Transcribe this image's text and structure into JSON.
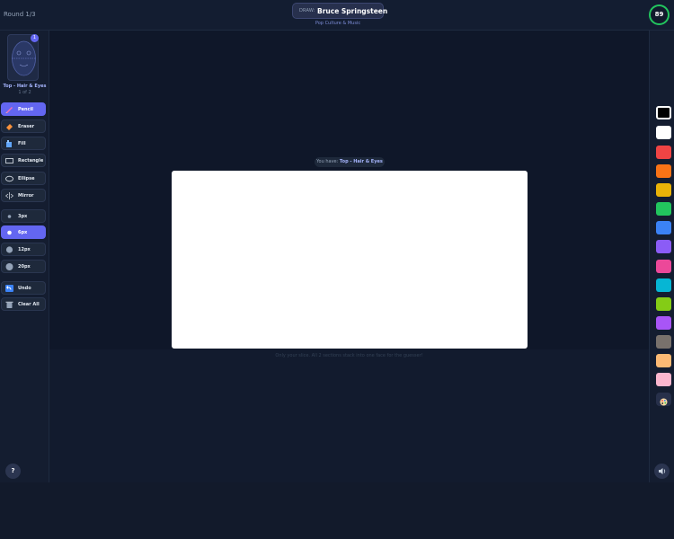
{
  "header": {
    "round": "Round 1/3",
    "draw_prefix": "DRAW:",
    "draw_word": "Bruce Springsteen",
    "category": "Pop Culture & Music",
    "timer": "89"
  },
  "section": {
    "badge": "1",
    "name": "Top - Hair & Eyes",
    "count": "1 of 2"
  },
  "tools": [
    {
      "label": "Pencil",
      "icon": "pencil-icon",
      "active": true
    },
    {
      "label": "Eraser",
      "icon": "eraser-icon",
      "active": false
    },
    {
      "label": "Fill",
      "icon": "fill-icon",
      "active": false
    },
    {
      "label": "Rectangle",
      "icon": "rectangle-icon",
      "active": false
    },
    {
      "label": "Ellipse",
      "icon": "ellipse-icon",
      "active": false
    },
    {
      "label": "Mirror",
      "icon": "mirror-icon",
      "active": false
    }
  ],
  "sizes": [
    {
      "label": "3px",
      "active": false
    },
    {
      "label": "6px",
      "active": true
    },
    {
      "label": "12px",
      "active": false
    },
    {
      "label": "20px",
      "active": false
    }
  ],
  "actions": {
    "undo": "Undo",
    "clear": "Clear All"
  },
  "canvas": {
    "you_have_prefix": "You have:",
    "you_have_section": "Top - Hair & Eyes",
    "hint": "Only your slice. All 2 sections stack into one face for the guesser!"
  },
  "palette": [
    {
      "color": "#000000",
      "selected": true
    },
    {
      "color": "#ffffff",
      "selected": false
    },
    {
      "color": "#ef4444",
      "selected": false
    },
    {
      "color": "#f97316",
      "selected": false
    },
    {
      "color": "#eab308",
      "selected": false
    },
    {
      "color": "#22c55e",
      "selected": false
    },
    {
      "color": "#3b82f6",
      "selected": false
    },
    {
      "color": "#8b5cf6",
      "selected": false
    },
    {
      "color": "#ec4899",
      "selected": false
    },
    {
      "color": "#06b6d4",
      "selected": false
    },
    {
      "color": "#84cc16",
      "selected": false
    },
    {
      "color": "#a855f7",
      "selected": false
    },
    {
      "color": "#78716c",
      "selected": false
    },
    {
      "color": "#fdba74",
      "selected": false
    },
    {
      "color": "#fbb6ce",
      "selected": false
    }
  ],
  "controls": {
    "help": "?"
  }
}
